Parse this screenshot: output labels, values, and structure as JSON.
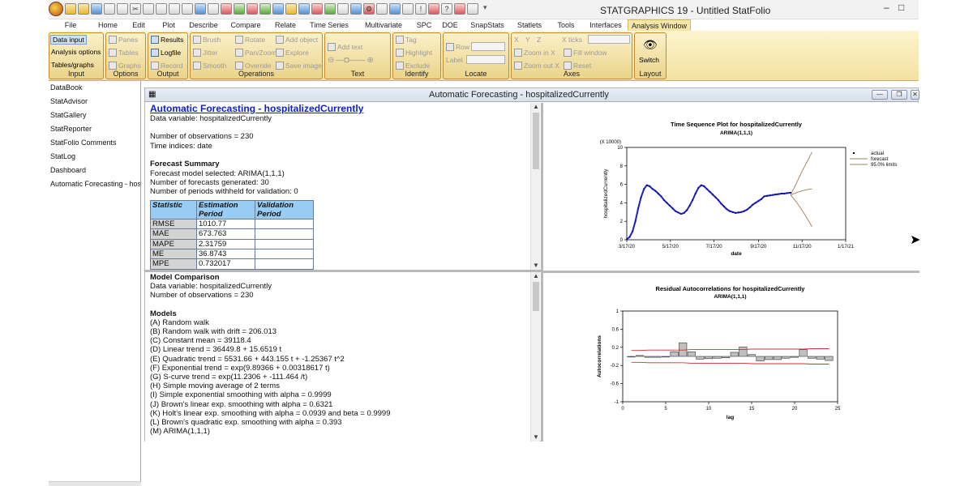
{
  "window": {
    "title": "STATGRAPHICS 19 - Untitled StatFolio",
    "controls": [
      "–",
      "□",
      "✕"
    ]
  },
  "menu": [
    "File",
    "Home",
    "Edit",
    "Plot",
    "Describe",
    "Compare",
    "Relate",
    "Time Series",
    "Multivariate",
    "SPC",
    "DOE",
    "SnapStats",
    "Statlets",
    "Tools",
    "Interfaces",
    "Analysis Window"
  ],
  "menu_active": "Analysis Window",
  "ribbon": {
    "input": {
      "label": "Input",
      "items": [
        "Data input",
        "Analysis options",
        "Tables/graphs"
      ]
    },
    "options": {
      "label": "Options",
      "items": [
        "Panes",
        "Tables",
        "Graphs"
      ]
    },
    "output": {
      "label": "Output",
      "items": [
        "Results",
        "Logfile",
        "Record"
      ]
    },
    "operations": {
      "label": "Operations",
      "items": [
        "Brush",
        "Rotate",
        "Add object",
        "Jitter",
        "Pan/Zoom",
        "Explore",
        "Smooth",
        "Override",
        "Save image"
      ]
    },
    "text": {
      "label": "Text",
      "items": [
        "Add text"
      ]
    },
    "identify": {
      "label": "Identify",
      "items": [
        "Tag",
        "Highlight",
        "Exclude"
      ]
    },
    "locate": {
      "label": "Locate",
      "items": [
        "Row",
        "Label"
      ]
    },
    "axes": {
      "label": "Axes",
      "items": [
        "X",
        "Y",
        "Z",
        "X ticks",
        "Zoom in X",
        "Fill window",
        "Zoom out X",
        "Reset"
      ]
    },
    "layout": {
      "label": "Layout",
      "items": [
        "Switch"
      ]
    }
  },
  "sidebar": [
    "DataBook",
    "StatAdvisor",
    "StatGallery",
    "StatReporter",
    "StatFolio Comments",
    "StatLog",
    "Dashboard",
    "Automatic Forecasting - hosp"
  ],
  "analysis": {
    "window_title": "Automatic Forecasting - hospitalizedCurrently",
    "heading": "Automatic Forecasting - hospitalizedCurrently",
    "data_variable": "Data variable: hospitalizedCurrently",
    "n_obs": "Number of observations = 230",
    "time_indices": "Time indices: date",
    "forecast_summary_title": "Forecast Summary",
    "forecast_lines": [
      "Forecast model selected: ARIMA(1,1,1)",
      "Number of forecasts generated: 30",
      "Number of periods withheld for validation: 0"
    ],
    "table_headers": [
      "Statistic",
      "Estimation Period",
      "Validation Period"
    ],
    "table_rows": [
      [
        "RMSE",
        "1010.77",
        ""
      ],
      [
        "MAE",
        "673.763",
        ""
      ],
      [
        "MAPE",
        "2.31759",
        ""
      ],
      [
        "ME",
        "36.8743",
        ""
      ],
      [
        "MPE",
        "0.732017",
        ""
      ]
    ]
  },
  "comparison": {
    "title": "Model Comparison",
    "data_variable": "Data variable: hospitalizedCurrently",
    "n_obs": "Number of observations = 230",
    "models_title": "Models",
    "models": [
      "(A) Random walk",
      "(B) Random walk with drift = 206.013",
      "(C) Constant mean = 39118.4",
      "(D) Linear trend = 36449.8 + 15.6519 t",
      "(E) Quadratic trend = 5531.66 + 443.155 t  + -1.25367 t^2",
      "(F) Exponential trend = exp(9.89366 + 0.00318617 t)",
      "(G) S-curve trend = exp(11.2306 + -111.464 /t)",
      "(H) Simple moving average of 2 terms",
      "(I) Simple exponential smoothing with alpha = 0.9999",
      "(J) Brown's linear exp. smoothing with alpha = 0.6321",
      "(K) Holt's linear exp. smoothing with alpha = 0.0939 and beta = 0.9999",
      "(L) Brown's quadratic exp. smoothing with alpha = 0.393",
      "(M) ARIMA(1,1,1)"
    ]
  },
  "chart_data": [
    {
      "type": "line",
      "title": "Time Sequence Plot for hospitalizedCurrently",
      "subtitle": "ARIMA(1,1,1)",
      "xlabel": "date",
      "ylabel": "hospitalizedCurrently",
      "y_multiplier_label": "(X 10000)",
      "x_ticks": [
        "3/17/20",
        "5/17/20",
        "7/17/20",
        "9/17/20",
        "11/17/20",
        "1/17/21"
      ],
      "x_tick_days": [
        0,
        61,
        122,
        184,
        245,
        306
      ],
      "y_ticks": [
        0,
        2,
        4,
        6,
        8,
        10
      ],
      "ylim": [
        0,
        10
      ],
      "legend": [
        "actual",
        "forecast",
        "95.0% limits"
      ],
      "legend_position": "top-right",
      "series": [
        {
          "name": "actual",
          "x": [
            0,
            4,
            8,
            12,
            16,
            20,
            24,
            28,
            32,
            36,
            40,
            44,
            48,
            52,
            56,
            60,
            64,
            68,
            72,
            76,
            80,
            84,
            88,
            92,
            96,
            100,
            104,
            108,
            112,
            116,
            120,
            124,
            128,
            132,
            136,
            140,
            144,
            148,
            152,
            156,
            160,
            164,
            168,
            172,
            176,
            180,
            184,
            188,
            192,
            196,
            200,
            204,
            208,
            212,
            216,
            220,
            224,
            229
          ],
          "values": [
            0.05,
            0.3,
            0.9,
            2.0,
            3.4,
            4.6,
            5.5,
            5.9,
            5.8,
            5.5,
            5.3,
            5.0,
            4.7,
            4.3,
            4.0,
            3.7,
            3.4,
            3.1,
            2.95,
            2.8,
            2.9,
            3.2,
            3.7,
            4.3,
            5.0,
            5.6,
            5.9,
            5.8,
            5.5,
            5.2,
            4.9,
            4.6,
            4.3,
            3.9,
            3.6,
            3.3,
            3.1,
            3.0,
            2.9,
            2.95,
            3.0,
            3.1,
            3.25,
            3.5,
            3.8,
            4.0,
            4.2,
            4.4,
            4.7,
            4.75,
            4.8,
            4.85,
            4.9,
            4.95,
            5.0,
            5.0,
            5.05,
            5.1
          ]
        },
        {
          "name": "forecast",
          "x": [
            229,
            237,
            245,
            253,
            259
          ],
          "values": [
            4.85,
            5.1,
            5.3,
            5.45,
            5.5
          ]
        },
        {
          "name": "95.0% limits upper",
          "x": [
            229,
            237,
            245,
            253,
            259
          ],
          "values": [
            4.85,
            6.1,
            7.4,
            8.6,
            9.5
          ]
        },
        {
          "name": "95.0% limits lower",
          "x": [
            229,
            237,
            245,
            253,
            259
          ],
          "values": [
            4.85,
            4.1,
            3.2,
            2.2,
            1.4
          ]
        }
      ]
    },
    {
      "type": "bar",
      "title": "Residual Autocorrelations for hospitalizedCurrently",
      "subtitle": "ARIMA(1,1,1)",
      "xlabel": "lag",
      "ylabel": "Autocorrelations",
      "x_ticks": [
        0,
        5,
        10,
        15,
        20,
        25
      ],
      "y_ticks": [
        -1,
        -0.6,
        -0.2,
        0.2,
        0.6,
        1
      ],
      "y_tick_labels": [
        "-1",
        "-0.6",
        "-0.2",
        "0.2",
        "0.6",
        "1"
      ],
      "ylim": [
        -1,
        1
      ],
      "xlim": [
        0,
        25
      ],
      "categories": [
        1,
        2,
        3,
        4,
        5,
        6,
        7,
        8,
        9,
        10,
        11,
        12,
        13,
        14,
        15,
        16,
        17,
        18,
        19,
        20,
        21,
        22,
        23,
        24
      ],
      "values": [
        -0.01,
        0.02,
        -0.02,
        -0.02,
        -0.01,
        0.1,
        0.3,
        0.1,
        -0.06,
        -0.05,
        -0.04,
        -0.03,
        0.09,
        0.21,
        0.04,
        -0.1,
        -0.07,
        -0.07,
        -0.04,
        -0.02,
        0.15,
        -0.04,
        -0.06,
        -0.09
      ],
      "limits_upper": [
        0.13,
        0.13,
        0.14,
        0.14,
        0.14,
        0.14,
        0.14,
        0.15,
        0.15,
        0.15,
        0.15,
        0.15,
        0.15,
        0.15,
        0.16,
        0.16,
        0.16,
        0.16,
        0.16,
        0.16,
        0.16,
        0.17,
        0.17,
        0.17
      ],
      "limits_lower": [
        -0.13,
        -0.13,
        -0.14,
        -0.14,
        -0.14,
        -0.14,
        -0.14,
        -0.15,
        -0.15,
        -0.15,
        -0.15,
        -0.15,
        -0.15,
        -0.15,
        -0.16,
        -0.16,
        -0.16,
        -0.16,
        -0.16,
        -0.16,
        -0.16,
        -0.17,
        -0.17,
        -0.17
      ]
    }
  ],
  "colors": {
    "ribbon_bg": "#f3e2a0",
    "ribbon_border": "#c88a2a",
    "table_header": "#99ccf3",
    "link": "#1020c8",
    "actual": "#2020c0",
    "forecast_lines": "#a08060",
    "acf_limit": "#d03030",
    "acf_bar": "#c0c0c0"
  }
}
